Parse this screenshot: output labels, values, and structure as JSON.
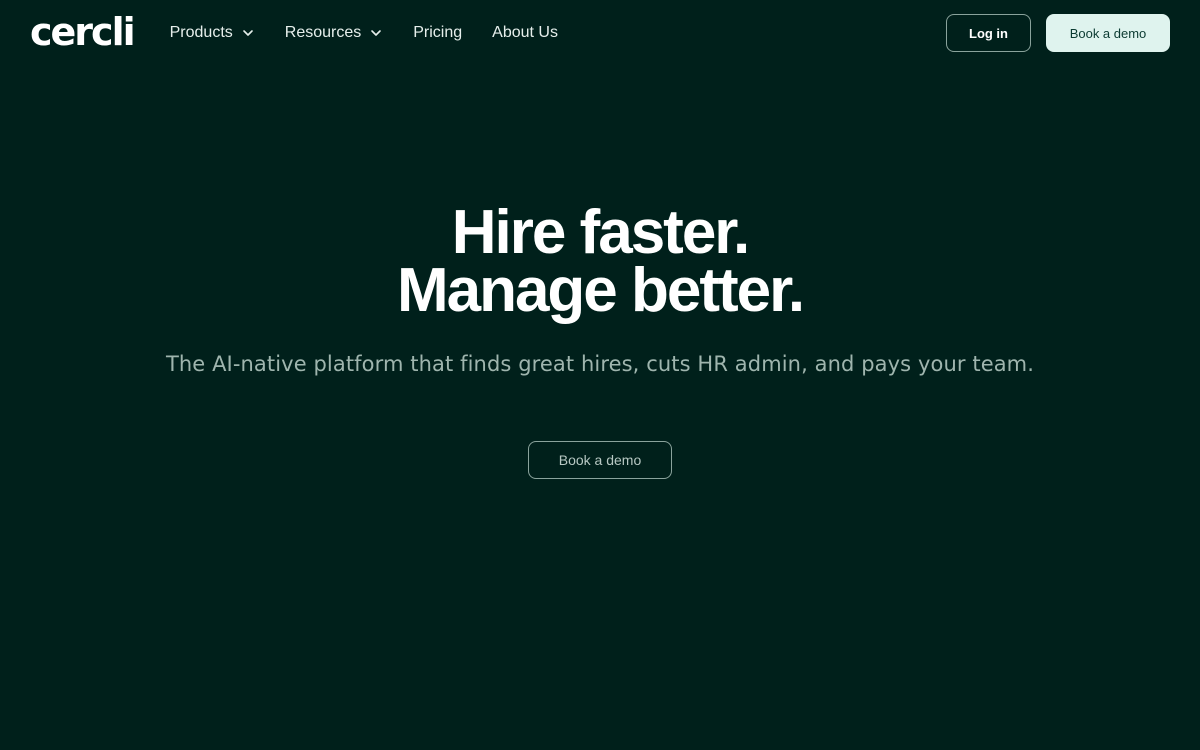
{
  "nav": {
    "logo_text": "cercli",
    "items": [
      {
        "label": "Products",
        "has_dropdown": true,
        "icon": "chevron-down-icon"
      },
      {
        "label": "Resources",
        "has_dropdown": true,
        "icon": "chevron-down-icon"
      },
      {
        "label": "Pricing",
        "has_dropdown": false
      },
      {
        "label": "About Us",
        "has_dropdown": false
      }
    ],
    "login_label": "Log in",
    "demo_label": "Book a demo"
  },
  "hero": {
    "headline_line1": "Hire faster.",
    "headline_line2": "Manage better.",
    "subheadline": "The AI-native platform that finds great hires, cuts HR admin, and pays your team.",
    "cta_label": "Book a demo"
  },
  "colors": {
    "background": "#00201b",
    "headline": "#ffffff",
    "subheadline": "#9fb5ae",
    "primary_button_bg": "#dff3ee"
  }
}
